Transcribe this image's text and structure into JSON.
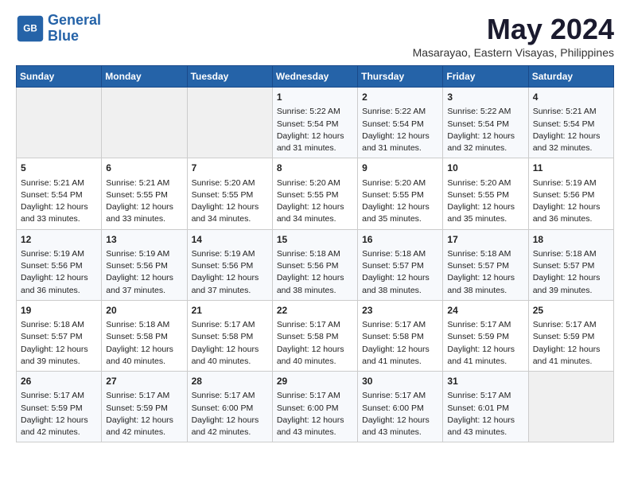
{
  "header": {
    "logo_line1": "General",
    "logo_line2": "Blue",
    "month": "May 2024",
    "location": "Masarayao, Eastern Visayas, Philippines"
  },
  "weekdays": [
    "Sunday",
    "Monday",
    "Tuesday",
    "Wednesday",
    "Thursday",
    "Friday",
    "Saturday"
  ],
  "weeks": [
    [
      {
        "day": "",
        "info": ""
      },
      {
        "day": "",
        "info": ""
      },
      {
        "day": "",
        "info": ""
      },
      {
        "day": "1",
        "info": "Sunrise: 5:22 AM\nSunset: 5:54 PM\nDaylight: 12 hours and 31 minutes."
      },
      {
        "day": "2",
        "info": "Sunrise: 5:22 AM\nSunset: 5:54 PM\nDaylight: 12 hours and 31 minutes."
      },
      {
        "day": "3",
        "info": "Sunrise: 5:22 AM\nSunset: 5:54 PM\nDaylight: 12 hours and 32 minutes."
      },
      {
        "day": "4",
        "info": "Sunrise: 5:21 AM\nSunset: 5:54 PM\nDaylight: 12 hours and 32 minutes."
      }
    ],
    [
      {
        "day": "5",
        "info": "Sunrise: 5:21 AM\nSunset: 5:54 PM\nDaylight: 12 hours and 33 minutes."
      },
      {
        "day": "6",
        "info": "Sunrise: 5:21 AM\nSunset: 5:55 PM\nDaylight: 12 hours and 33 minutes."
      },
      {
        "day": "7",
        "info": "Sunrise: 5:20 AM\nSunset: 5:55 PM\nDaylight: 12 hours and 34 minutes."
      },
      {
        "day": "8",
        "info": "Sunrise: 5:20 AM\nSunset: 5:55 PM\nDaylight: 12 hours and 34 minutes."
      },
      {
        "day": "9",
        "info": "Sunrise: 5:20 AM\nSunset: 5:55 PM\nDaylight: 12 hours and 35 minutes."
      },
      {
        "day": "10",
        "info": "Sunrise: 5:20 AM\nSunset: 5:55 PM\nDaylight: 12 hours and 35 minutes."
      },
      {
        "day": "11",
        "info": "Sunrise: 5:19 AM\nSunset: 5:56 PM\nDaylight: 12 hours and 36 minutes."
      }
    ],
    [
      {
        "day": "12",
        "info": "Sunrise: 5:19 AM\nSunset: 5:56 PM\nDaylight: 12 hours and 36 minutes."
      },
      {
        "day": "13",
        "info": "Sunrise: 5:19 AM\nSunset: 5:56 PM\nDaylight: 12 hours and 37 minutes."
      },
      {
        "day": "14",
        "info": "Sunrise: 5:19 AM\nSunset: 5:56 PM\nDaylight: 12 hours and 37 minutes."
      },
      {
        "day": "15",
        "info": "Sunrise: 5:18 AM\nSunset: 5:56 PM\nDaylight: 12 hours and 38 minutes."
      },
      {
        "day": "16",
        "info": "Sunrise: 5:18 AM\nSunset: 5:57 PM\nDaylight: 12 hours and 38 minutes."
      },
      {
        "day": "17",
        "info": "Sunrise: 5:18 AM\nSunset: 5:57 PM\nDaylight: 12 hours and 38 minutes."
      },
      {
        "day": "18",
        "info": "Sunrise: 5:18 AM\nSunset: 5:57 PM\nDaylight: 12 hours and 39 minutes."
      }
    ],
    [
      {
        "day": "19",
        "info": "Sunrise: 5:18 AM\nSunset: 5:57 PM\nDaylight: 12 hours and 39 minutes."
      },
      {
        "day": "20",
        "info": "Sunrise: 5:18 AM\nSunset: 5:58 PM\nDaylight: 12 hours and 40 minutes."
      },
      {
        "day": "21",
        "info": "Sunrise: 5:17 AM\nSunset: 5:58 PM\nDaylight: 12 hours and 40 minutes."
      },
      {
        "day": "22",
        "info": "Sunrise: 5:17 AM\nSunset: 5:58 PM\nDaylight: 12 hours and 40 minutes."
      },
      {
        "day": "23",
        "info": "Sunrise: 5:17 AM\nSunset: 5:58 PM\nDaylight: 12 hours and 41 minutes."
      },
      {
        "day": "24",
        "info": "Sunrise: 5:17 AM\nSunset: 5:59 PM\nDaylight: 12 hours and 41 minutes."
      },
      {
        "day": "25",
        "info": "Sunrise: 5:17 AM\nSunset: 5:59 PM\nDaylight: 12 hours and 41 minutes."
      }
    ],
    [
      {
        "day": "26",
        "info": "Sunrise: 5:17 AM\nSunset: 5:59 PM\nDaylight: 12 hours and 42 minutes."
      },
      {
        "day": "27",
        "info": "Sunrise: 5:17 AM\nSunset: 5:59 PM\nDaylight: 12 hours and 42 minutes."
      },
      {
        "day": "28",
        "info": "Sunrise: 5:17 AM\nSunset: 6:00 PM\nDaylight: 12 hours and 42 minutes."
      },
      {
        "day": "29",
        "info": "Sunrise: 5:17 AM\nSunset: 6:00 PM\nDaylight: 12 hours and 43 minutes."
      },
      {
        "day": "30",
        "info": "Sunrise: 5:17 AM\nSunset: 6:00 PM\nDaylight: 12 hours and 43 minutes."
      },
      {
        "day": "31",
        "info": "Sunrise: 5:17 AM\nSunset: 6:01 PM\nDaylight: 12 hours and 43 minutes."
      },
      {
        "day": "",
        "info": ""
      }
    ]
  ]
}
